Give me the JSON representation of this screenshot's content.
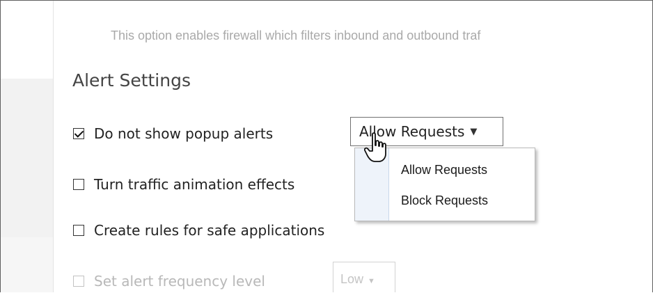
{
  "firewall": {
    "description": "This option enables firewall which filters inbound and outbound traf"
  },
  "alert_settings": {
    "title": "Alert Settings",
    "options": [
      {
        "label": "Do not show popup alerts",
        "checked": true,
        "enabled": true
      },
      {
        "label": "Turn traffic animation effects",
        "checked": false,
        "enabled": true
      },
      {
        "label": "Create rules for safe applications",
        "checked": false,
        "enabled": true
      },
      {
        "label": "Set alert frequency level",
        "checked": false,
        "enabled": false
      }
    ],
    "popup_action_select": {
      "value": "Allow Requests",
      "options": [
        "Allow Requests",
        "Block Requests"
      ]
    },
    "frequency_select": {
      "value": "Low"
    }
  },
  "icons": {
    "dropdown_arrow": "triangle-down",
    "cursor": "hand-pointer"
  }
}
